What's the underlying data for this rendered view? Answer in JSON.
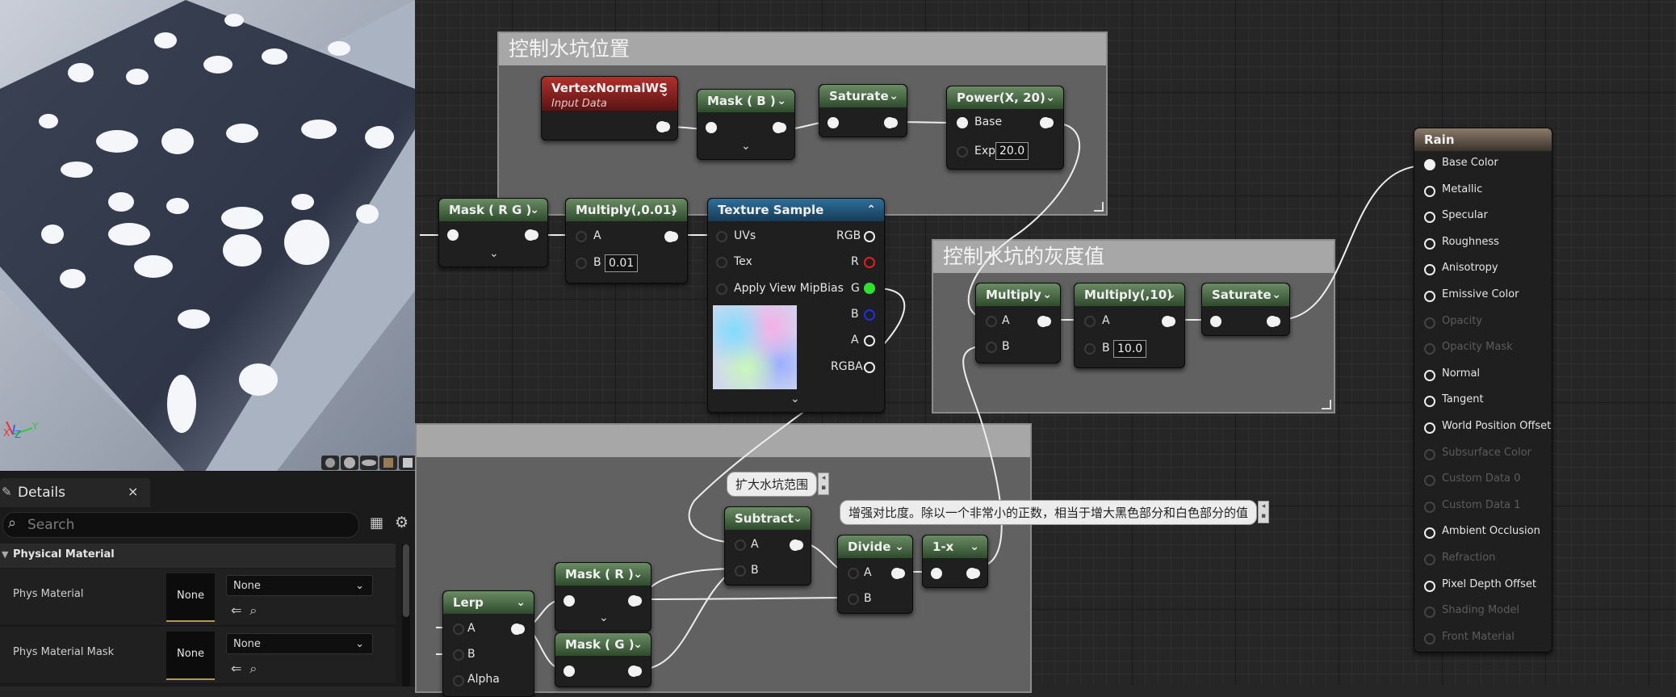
{
  "comments": {
    "position": "控制水坑位置",
    "gray": "控制水坑的灰度值",
    "third": ""
  },
  "nodes": {
    "vertex_normal": {
      "title": "VertexNormalWS",
      "subtitle": "Input Data"
    },
    "mask_b": {
      "title": "Mask ( B )"
    },
    "saturate_top": {
      "title": "Saturate"
    },
    "power": {
      "title": "Power(X, 20)",
      "base_label": "Base",
      "exp_label": "Exp",
      "exp_value": "20.0"
    },
    "mask_rg": {
      "title": "Mask ( R G )"
    },
    "multiply_001": {
      "title": "Multiply(,0.01)",
      "a_label": "A",
      "b_label": "B",
      "b_value": "0.01"
    },
    "texture_sample": {
      "title": "Texture Sample",
      "uvs": "UVs",
      "tex": "Tex",
      "mipbias": "Apply View MipBias",
      "rgb": "RGB",
      "r": "R",
      "g": "G",
      "b": "B",
      "a": "A",
      "rgba": "RGBA"
    },
    "multiply": {
      "title": "Multiply",
      "a_label": "A",
      "b_label": "B"
    },
    "multiply_10": {
      "title": "Multiply(,10)",
      "a_label": "A",
      "b_label": "B",
      "b_value": "10.0"
    },
    "saturate_gray": {
      "title": "Saturate"
    },
    "subtract": {
      "title": "Subtract",
      "a_label": "A",
      "b_label": "B"
    },
    "divide": {
      "title": "Divide",
      "a_label": "A",
      "b_label": "B"
    },
    "one_minus": {
      "title": "1-x"
    },
    "lerp": {
      "title": "Lerp",
      "a_label": "A",
      "b_label": "B",
      "alpha_label": "Alpha"
    },
    "mask_r": {
      "title": "Mask ( R )"
    },
    "mask_g": {
      "title": "Mask ( G )"
    }
  },
  "notes": {
    "expand": "扩大水坑范围",
    "contrast": "增强对比度。除以一个非常小的正数，相当于增大黑色部分和白色部分的值"
  },
  "result": {
    "title": "Rain",
    "pins": [
      {
        "label": "Base Color",
        "enabled": true
      },
      {
        "label": "Metallic",
        "enabled": true
      },
      {
        "label": "Specular",
        "enabled": true
      },
      {
        "label": "Roughness",
        "enabled": true
      },
      {
        "label": "Anisotropy",
        "enabled": true
      },
      {
        "label": "Emissive Color",
        "enabled": true
      },
      {
        "label": "Opacity",
        "enabled": false
      },
      {
        "label": "Opacity Mask",
        "enabled": false
      },
      {
        "label": "Normal",
        "enabled": true
      },
      {
        "label": "Tangent",
        "enabled": true
      },
      {
        "label": "World Position Offset",
        "enabled": true
      },
      {
        "label": "Subsurface Color",
        "enabled": false
      },
      {
        "label": "Custom Data 0",
        "enabled": false
      },
      {
        "label": "Custom Data 1",
        "enabled": false
      },
      {
        "label": "Ambient Occlusion",
        "enabled": true
      },
      {
        "label": "Refraction",
        "enabled": false
      },
      {
        "label": "Pixel Depth Offset",
        "enabled": true
      },
      {
        "label": "Shading Model",
        "enabled": false
      },
      {
        "label": "Front Material",
        "enabled": false
      }
    ]
  },
  "details": {
    "tab_title": "Details",
    "search_placeholder": "Search",
    "category": "Physical Material",
    "rows": [
      {
        "label": "Phys Material",
        "thumb": "None",
        "value": "None"
      },
      {
        "label": "Phys Material Mask",
        "thumb": "None",
        "value": "None"
      }
    ]
  },
  "viewport": {
    "axis_x": "X",
    "axis_z": "Z",
    "axis_y": "Y"
  },
  "icons": [
    "close-icon",
    "search-icon",
    "table-view-icon",
    "settings-gear-icon",
    "dropdown-chevron-icon",
    "browse-arrow-icon",
    "use-selected-icon",
    "pencil-icon"
  ]
}
